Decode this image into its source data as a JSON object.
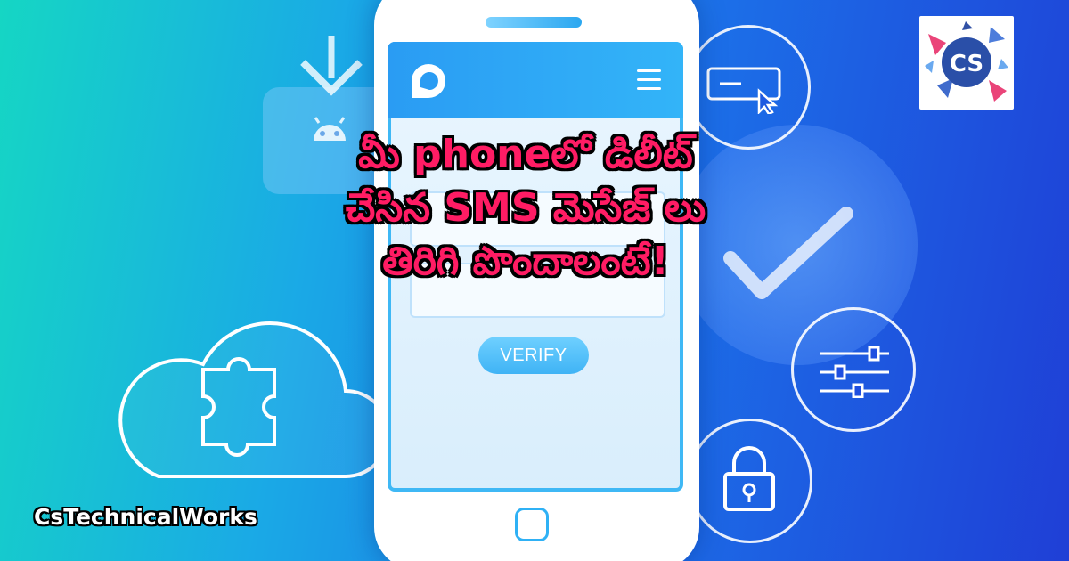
{
  "headline": {
    "line1": "మీ phoneలో డిలీట్",
    "line2": "చేసిన SMS మెసేజ్ లు",
    "line3": "తిరిగి పొందాలంటే!"
  },
  "phone": {
    "verify_label": "VERIFY",
    "app_logo_icon": "app-logo-icon",
    "menu_icon": "hamburger-menu-icon"
  },
  "icons": {
    "cloud": "cloud-icon",
    "puzzle": "puzzle-icon",
    "download": "download-arrow-icon",
    "android": "android-icon",
    "card_cursor": "browser-cursor-icon",
    "check": "checkmark-icon",
    "sliders": "sliders-icon",
    "lock": "lock-icon"
  },
  "brand": {
    "name": "CsTechnicalWorks",
    "logo_text": "CS"
  },
  "colors": {
    "headline": "#ff1c64",
    "accent": "#2fb1f5",
    "bg_left": "#15d6c4",
    "bg_right": "#1f3fd6"
  }
}
